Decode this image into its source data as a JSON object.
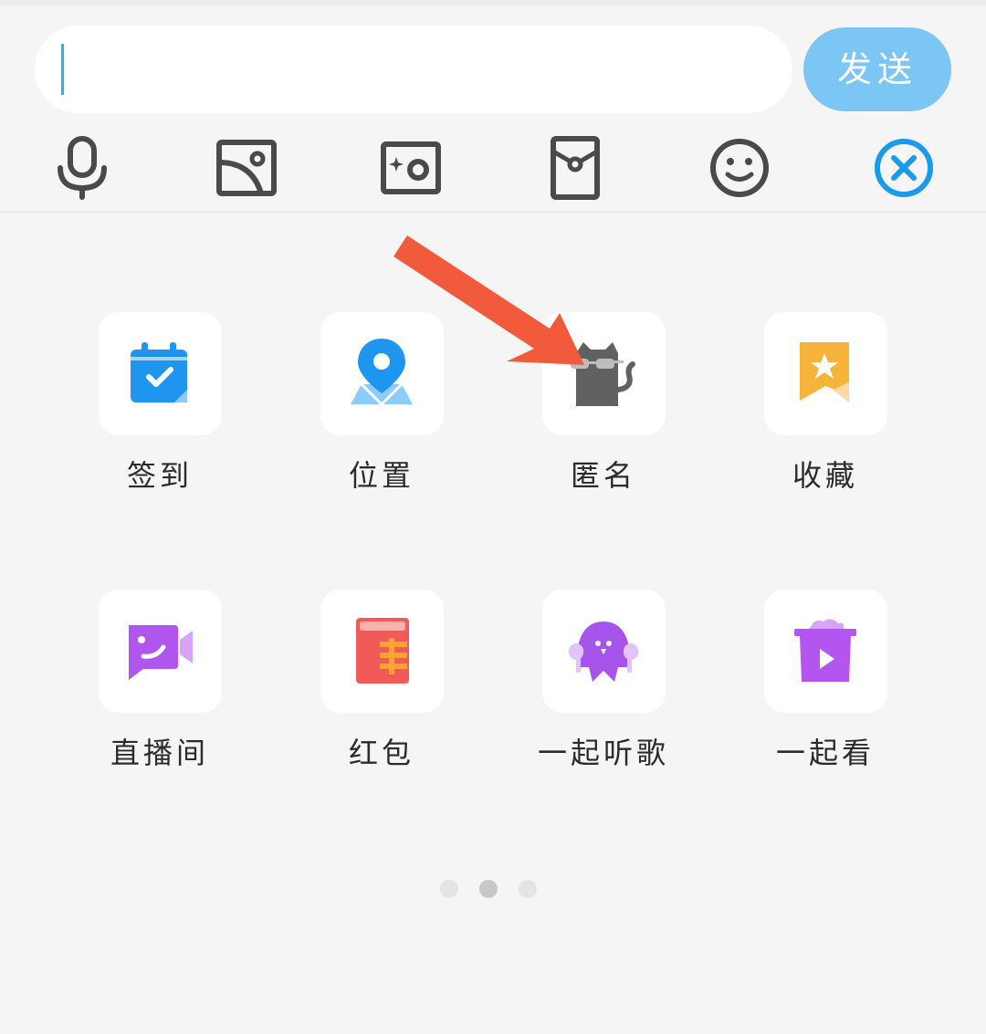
{
  "input": {
    "value": "",
    "send_label": "发送"
  },
  "toolbar": {
    "icons": [
      "microphone-icon",
      "image-icon",
      "camera-icon",
      "file-icon",
      "emoji-icon",
      "close-icon"
    ],
    "accent": "#1a9ae8"
  },
  "panel": {
    "items": [
      {
        "label": "签到",
        "icon": "calendar-check-icon",
        "color": "#1e96f0"
      },
      {
        "label": "位置",
        "icon": "location-pin-icon",
        "color": "#1e96f0"
      },
      {
        "label": "匿名",
        "icon": "anonymous-cat-icon",
        "color": "#616161"
      },
      {
        "label": "收藏",
        "icon": "bookmark-star-icon",
        "color": "#f7b43a"
      },
      {
        "label": "直播间",
        "icon": "video-chat-icon",
        "color": "#b155ef"
      },
      {
        "label": "红包",
        "icon": "red-packet-icon",
        "color": "#f25a5a"
      },
      {
        "label": "一起听歌",
        "icon": "headphones-bird-icon",
        "color": "#a654ea"
      },
      {
        "label": "一起看",
        "icon": "tv-play-icon",
        "color": "#b455ef"
      }
    ]
  },
  "pager": {
    "pages": 3,
    "current_page": 2
  },
  "annotation": {
    "arrow_color": "#f25a3c"
  }
}
